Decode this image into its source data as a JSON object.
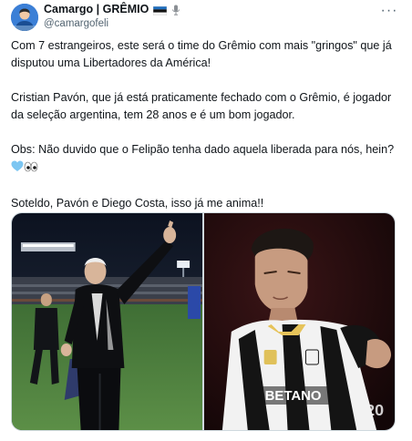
{
  "author": {
    "display_name": "Camargo | GRÊMIO",
    "handle": "@camargofeli",
    "flag_icon": "flag-icon",
    "mic_icon": "microphone-icon",
    "avatar_icon": "avatar"
  },
  "more_icon": "more-options-icon",
  "more_label": "···",
  "tweet": {
    "paragraph_1": "Com 7 estrangeiros, este será o time do Grêmio com mais \"gringos\" que já disputou uma Libertadores da América!",
    "paragraph_2": "Cristian Pavón, que já está praticamente fechado com o Grêmio, é jogador da seleção argentina, tem 28 anos e é um bom jogador.",
    "paragraph_3": "Obs: Não duvido que o Felipão tenha dado aquela liberada para nós, hein?",
    "paragraph_4": "Soteldo, Pavón e Diego Costa, isso já me anima!!"
  },
  "media": {
    "photo_1": "coach-photo",
    "photo_2": "player-photo",
    "jersey_text": "BETANO"
  },
  "colors": {
    "text": "#0f1419",
    "secondary": "#536471",
    "border": "#cfd9de",
    "heart": "#7cc6f2"
  }
}
